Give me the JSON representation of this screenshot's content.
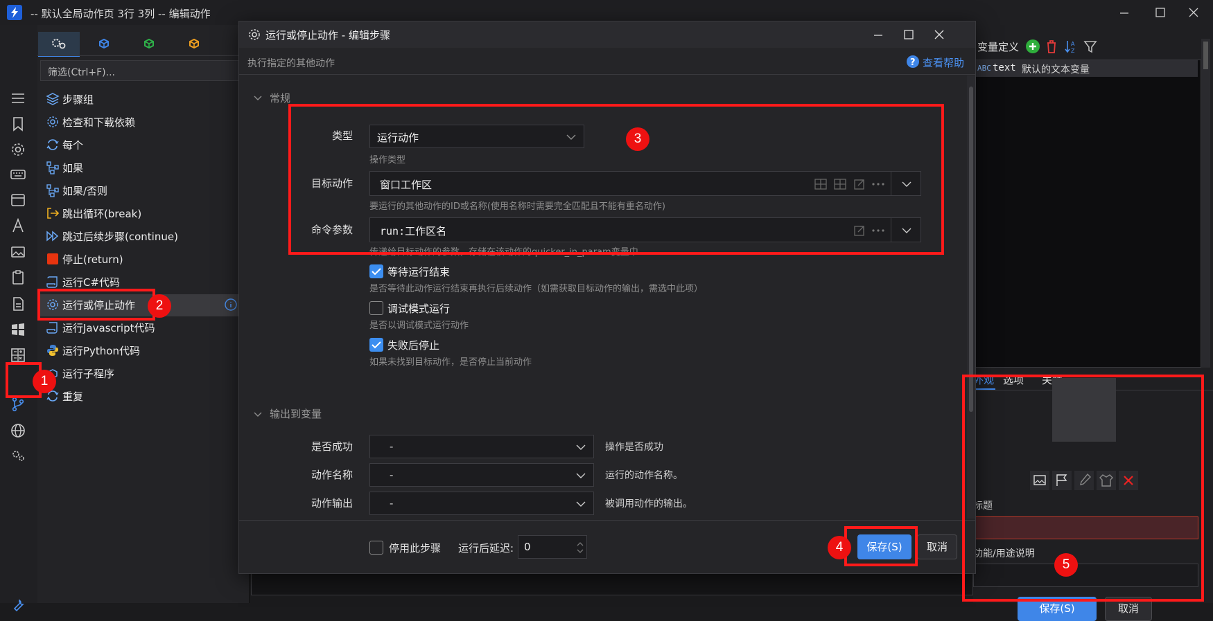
{
  "window": {
    "title": "-- 默认全局动作页 3行 3列 -- 编辑动作"
  },
  "toolbox": {
    "filter_placeholder": "筛选(Ctrl+F)...",
    "items": [
      "步骤组",
      "检查和下载依赖",
      "每个",
      "如果",
      "如果/否则",
      "跳出循环(break)",
      "跳过后续步骤(continue)",
      "停止(return)",
      "运行C#代码",
      "运行或停止动作",
      "运行Javascript代码",
      "运行Python代码",
      "运行子程序",
      "重复"
    ],
    "selected_index": 9
  },
  "right_panel": {
    "var_header": "变量定义",
    "var_row": {
      "type": "ABC",
      "name": "text",
      "desc": "默认的文本变量"
    },
    "tabs": [
      "外观",
      "选项",
      "关联"
    ],
    "title_label": "标题",
    "desc_label": "功能/用途说明",
    "save_label": "保存(S)",
    "cancel_label": "取消"
  },
  "dialog": {
    "title": "运行或停止动作 - 编辑步骤",
    "subtitle": "执行指定的其他动作",
    "help": "查看帮助",
    "section_general": "常规",
    "type_label": "类型",
    "type_value": "运行动作",
    "type_desc": "操作类型",
    "target_label": "目标动作",
    "target_value": "窗口工作区",
    "target_desc": "要运行的其他动作的ID或名称(使用名称时需要完全匹配且不能有重名动作)",
    "param_label": "命令参数",
    "param_value": "run:工作区名",
    "param_desc": "传递给目标动作的参数，存储在该动作的quicker_in_param变量中",
    "wait_label": "等待运行结束",
    "wait_checked": true,
    "wait_desc": "是否等待此动作运行结束再执行后续动作（如需获取目标动作的输出，需选中此项）",
    "debug_label": "调试模式运行",
    "debug_checked": false,
    "debug_desc": "是否以调试模式运行动作",
    "stop_label": "失败后停止",
    "stop_checked": true,
    "stop_desc": "如果未找到目标动作，是否停止当前动作",
    "section_output": "输出到变量",
    "outputs": [
      {
        "label": "是否成功",
        "value": "-",
        "desc": "操作是否成功"
      },
      {
        "label": "动作名称",
        "value": "-",
        "desc": "运行的动作名称。"
      },
      {
        "label": "动作输出",
        "value": "-",
        "desc": "被调用动作的输出。"
      }
    ],
    "disable_label": "停用此步骤",
    "disable_checked": false,
    "delay_label": "运行后延迟:",
    "delay_value": "0",
    "save_label": "保存(S)",
    "cancel_label": "取消"
  },
  "annotations": [
    "1",
    "2",
    "3",
    "4",
    "5"
  ],
  "colors": {
    "accent": "#3f86e8",
    "highlight": "#ff1a1a",
    "background": "#1b1b1d"
  }
}
